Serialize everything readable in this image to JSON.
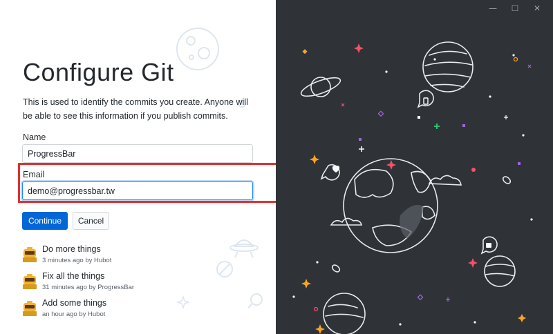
{
  "window": {
    "minimize": "—",
    "maximize": "☐",
    "close": "✕"
  },
  "title": "Configure Git",
  "description": "This is used to identify the commits you create. Anyone will be able to see this information if you publish commits.",
  "name_field": {
    "label": "Name",
    "value": "ProgressBar"
  },
  "email_field": {
    "label": "Email",
    "value": "demo@progressbar.tw"
  },
  "buttons": {
    "continue": "Continue",
    "cancel": "Cancel"
  },
  "commits": [
    {
      "summary": "Do more things",
      "meta": "3 minutes ago by Hubot"
    },
    {
      "summary": "Fix all the things",
      "meta": "31 minutes ago by ProgressBar"
    },
    {
      "summary": "Add some things",
      "meta": "an hour ago by Hubot"
    }
  ],
  "colors": {
    "accent": "#0366d6",
    "highlight": "#e03131",
    "panel_bg": "#2f3337"
  }
}
